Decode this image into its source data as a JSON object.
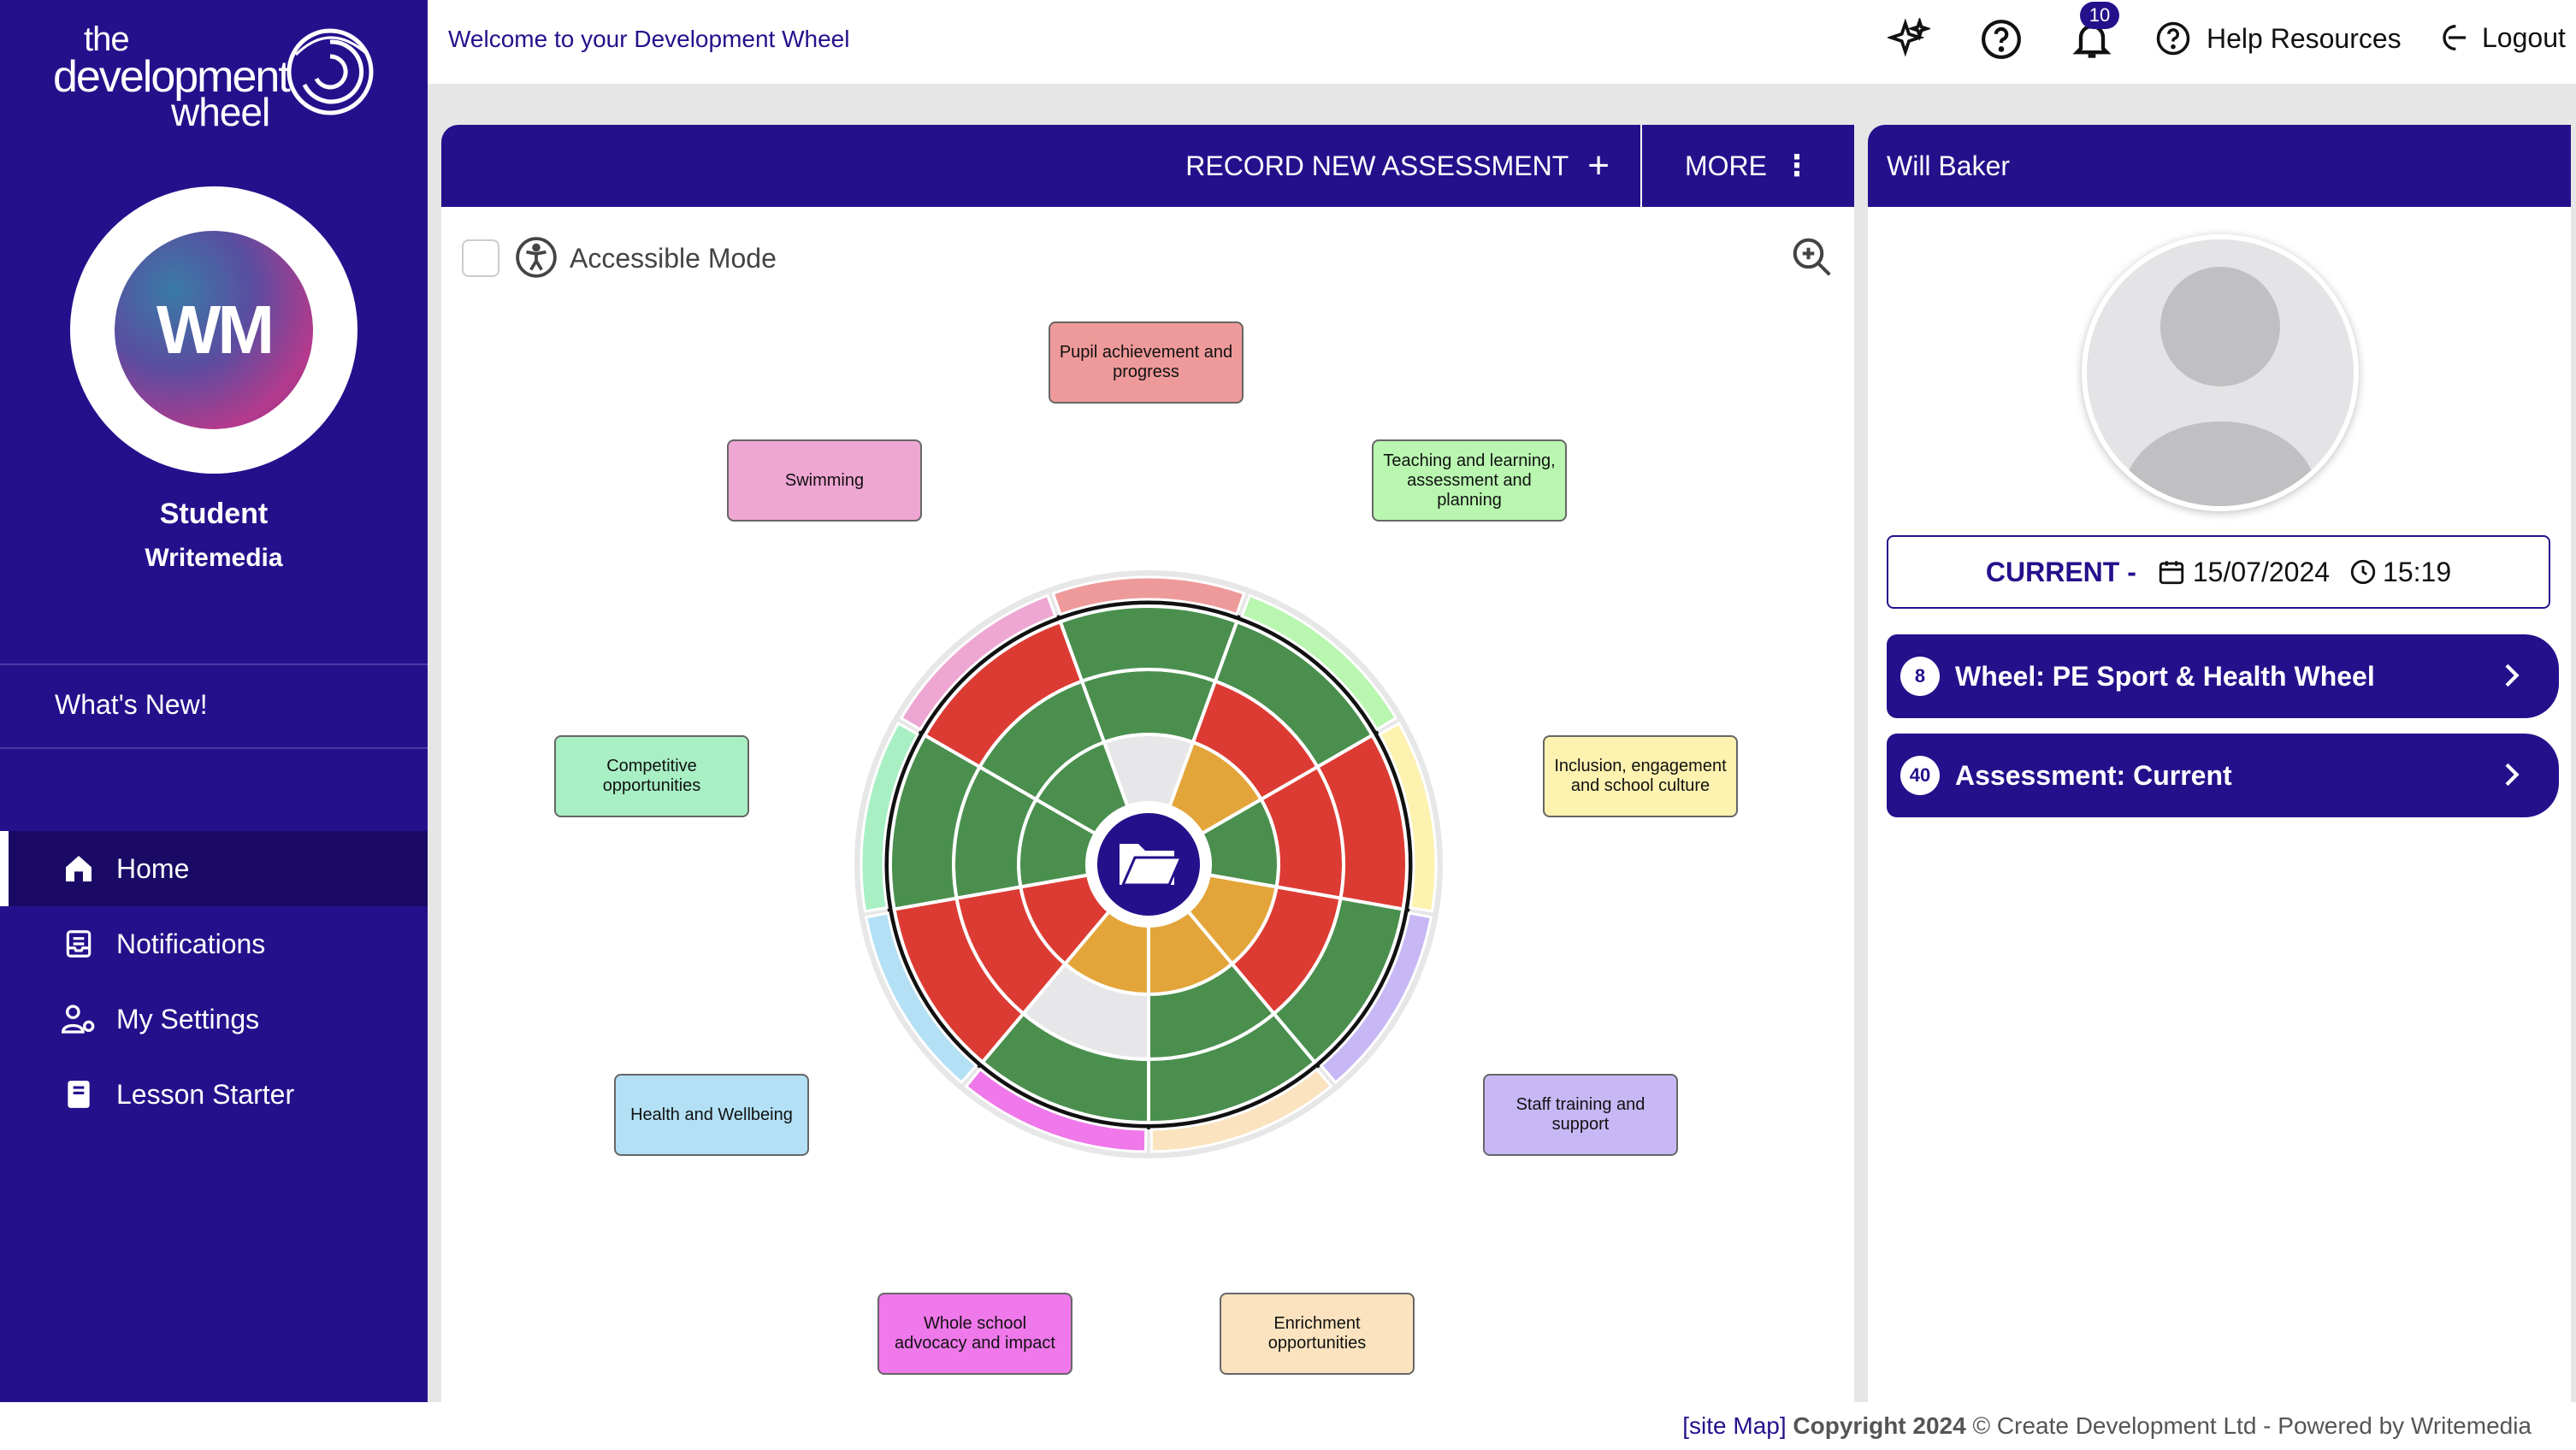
{
  "brand": {
    "logo_line1": "the",
    "logo_line2": "development",
    "logo_line3": "wheel",
    "color_primary": "#25108c"
  },
  "sidebar": {
    "avatar_initials": "WM",
    "user_role": "Student",
    "user_org": "Writemedia",
    "whats_new": "What's New!",
    "nav": [
      {
        "label": "Home",
        "icon": "home-icon",
        "active": true
      },
      {
        "label": "Notifications",
        "icon": "notifications-icon"
      },
      {
        "label": "My Settings",
        "icon": "user-settings-icon"
      },
      {
        "label": "Lesson Starter",
        "icon": "book-icon"
      }
    ]
  },
  "topbar": {
    "welcome": "Welcome to your Development Wheel",
    "notification_count": "10",
    "help_resources": "Help Resources",
    "logout": "Logout"
  },
  "main": {
    "record_btn": "RECORD NEW ASSESSMENT",
    "more_btn": "MORE",
    "accessible_mode": "Accessible Mode",
    "wheel_labels": [
      {
        "text": "Pupil achievement and progress",
        "color": "#ef9a9a"
      },
      {
        "text": "Teaching and learning, assessment and planning",
        "color": "#b9f6b0"
      },
      {
        "text": "Inclusion, engagement and school culture",
        "color": "#fdf2b0"
      },
      {
        "text": "Staff training and support",
        "color": "#c7b8f5"
      },
      {
        "text": "Enrichment opportunities",
        "color": "#fae3be"
      },
      {
        "text": "Whole school advocacy and impact",
        "color": "#ef78ea"
      },
      {
        "text": "Health and Wellbeing",
        "color": "#b3e0f5"
      },
      {
        "text": "Competitive opportunities",
        "color": "#a8efc4"
      },
      {
        "text": "Swimming",
        "color": "#eea6d2"
      }
    ],
    "rating_colors": {
      "green": "#4a8f4e",
      "red": "#dc3b33",
      "amber": "#e3a53a",
      "empty": "#e7e7e9"
    },
    "wheel_ratings": [
      [
        "empty",
        "green",
        "green"
      ],
      [
        "amber",
        "red",
        "green"
      ],
      [
        "green",
        "red",
        "red"
      ],
      [
        "amber",
        "red",
        "green"
      ],
      [
        "amber",
        "green",
        "green"
      ],
      [
        "amber",
        "empty",
        "green"
      ],
      [
        "red",
        "red",
        "red"
      ],
      [
        "green",
        "green",
        "green"
      ],
      [
        "green",
        "green",
        "red"
      ]
    ]
  },
  "profile": {
    "name": "Will Baker",
    "current_label": "CURRENT -",
    "date": "15/07/2024",
    "time": "15:19",
    "wheel_count": "8",
    "wheel_label": "Wheel: PE Sport & Health Wheel",
    "assessment_count": "40",
    "assessment_label": "Assessment: Current"
  },
  "footer": {
    "site_map": "[site Map]",
    "copyright": "Copyright 2024",
    "rest": "© Create Development Ltd - Powered by Writemedia"
  }
}
